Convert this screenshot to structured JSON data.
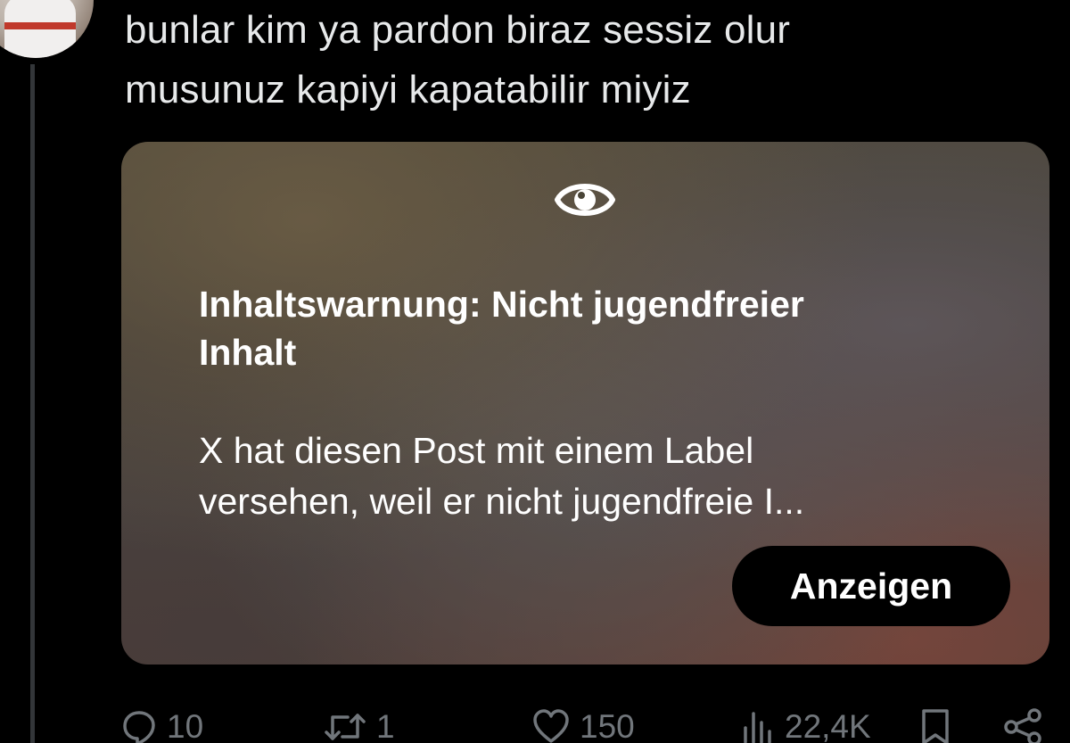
{
  "post": {
    "text_lines": [
      "bunlar kim ya pardon biraz sessiz olur",
      "musunuz kapiyi kapatabilir miyiz"
    ]
  },
  "media": {
    "icon": "eye-icon",
    "warning_title_lines": [
      "Inhaltswarnung: Nicht jugendfreier",
      "Inhalt"
    ],
    "warning_desc_lines": [
      "X hat diesen Post mit einem Label",
      "versehen, weil er nicht jugendfreie I..."
    ],
    "show_button_label": "Anzeigen"
  },
  "actions": {
    "reply": {
      "icon": "reply-icon",
      "count": "10"
    },
    "repost": {
      "icon": "repost-icon",
      "count": "1"
    },
    "like": {
      "icon": "heart-icon",
      "count": "150"
    },
    "views": {
      "icon": "views-icon",
      "count": "22,4K"
    },
    "bookmark": {
      "icon": "bookmark-icon"
    },
    "share": {
      "icon": "share-icon"
    }
  },
  "colors": {
    "background": "#000000",
    "text": "#e7e9ea",
    "muted": "#71767b",
    "button_bg": "#000000"
  }
}
